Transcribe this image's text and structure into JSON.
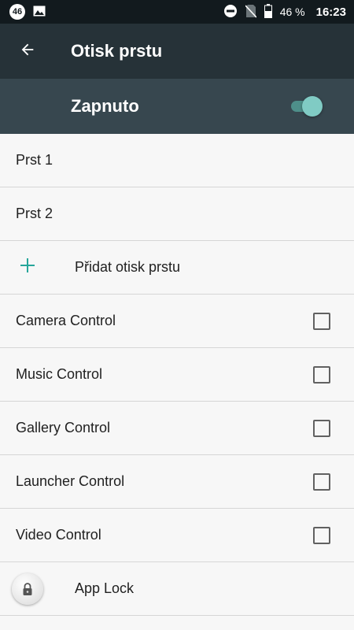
{
  "status_bar": {
    "network_badge": "46",
    "battery": "46 %",
    "time": "16:23",
    "icons": [
      "image-icon",
      "do-not-disturb-icon",
      "no-sim-icon",
      "battery-icon"
    ]
  },
  "app_bar": {
    "title": "Otisk prstu",
    "back_icon": "arrow-back-icon"
  },
  "master_switch": {
    "label": "Zapnuto",
    "on": true
  },
  "fingerprints": [
    {
      "label": "Prst 1"
    },
    {
      "label": "Prst 2"
    }
  ],
  "add_fingerprint": {
    "label": "Přidat otisk prstu",
    "icon": "plus-icon"
  },
  "controls": [
    {
      "label": "Camera Control",
      "checked": false
    },
    {
      "label": "Music Control",
      "checked": false
    },
    {
      "label": "Gallery Control",
      "checked": false
    },
    {
      "label": "Launcher Control",
      "checked": false
    },
    {
      "label": "Video Control",
      "checked": false
    }
  ],
  "app_lock": {
    "label": "App Lock",
    "icon": "lock-icon"
  },
  "colors": {
    "status_bar": "#121a1e",
    "app_bar": "#263238",
    "switch_bar": "#37474f",
    "accent": "#26a69a",
    "toggle_thumb": "#80cbc4"
  }
}
